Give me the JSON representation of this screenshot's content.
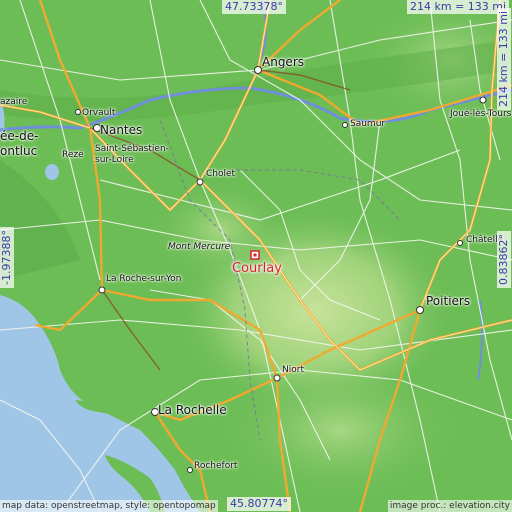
{
  "coordinates": {
    "top_lat": "47.73378°",
    "bottom_lat": "45.80774°",
    "left_lon": "-1.97388°",
    "right_lon": "0.83862°"
  },
  "scale": {
    "horizontal": "214 km = 133 mi",
    "vertical": "214 km = 133 mi"
  },
  "credits": {
    "left": "map data: openstreetmap, style: opentopomap",
    "right": "image proc.: elevation.city"
  },
  "target": {
    "name": "Courlay",
    "color": "#d8232a"
  },
  "places": [
    {
      "id": "angers",
      "name": "Angers"
    },
    {
      "id": "saumur",
      "name": "Saumur"
    },
    {
      "id": "joue",
      "name": "Joué-lès-Tours"
    },
    {
      "id": "orvault",
      "name": "Orvault"
    },
    {
      "id": "nantes",
      "name": "Nantes"
    },
    {
      "id": "reze",
      "name": "Rezé"
    },
    {
      "id": "stseb1",
      "name": "Saint-Sébastien-"
    },
    {
      "id": "stseb2",
      "name": "sur-Loire"
    },
    {
      "id": "nazaire",
      "name": "azaire"
    },
    {
      "id": "hede",
      "name": "ée-de-"
    },
    {
      "id": "ontluc",
      "name": "ontluc"
    },
    {
      "id": "cholet",
      "name": "Cholet"
    },
    {
      "id": "montmercure",
      "name": "Mont Mercure"
    },
    {
      "id": "chatelle",
      "name": "Châtelle"
    },
    {
      "id": "larochesuryon",
      "name": "La Roche-sur-Yon"
    },
    {
      "id": "poitiers",
      "name": "Poitiers"
    },
    {
      "id": "niort",
      "name": "Niort"
    },
    {
      "id": "larochelle",
      "name": "La Rochelle"
    },
    {
      "id": "rochefort",
      "name": "Rochefort"
    }
  ],
  "colors": {
    "land": "#6fbf5a",
    "sea": "#9fc6e6",
    "road_major": "#f2b33a",
    "road_minor": "#ffffff",
    "river": "#6f8fd8"
  }
}
